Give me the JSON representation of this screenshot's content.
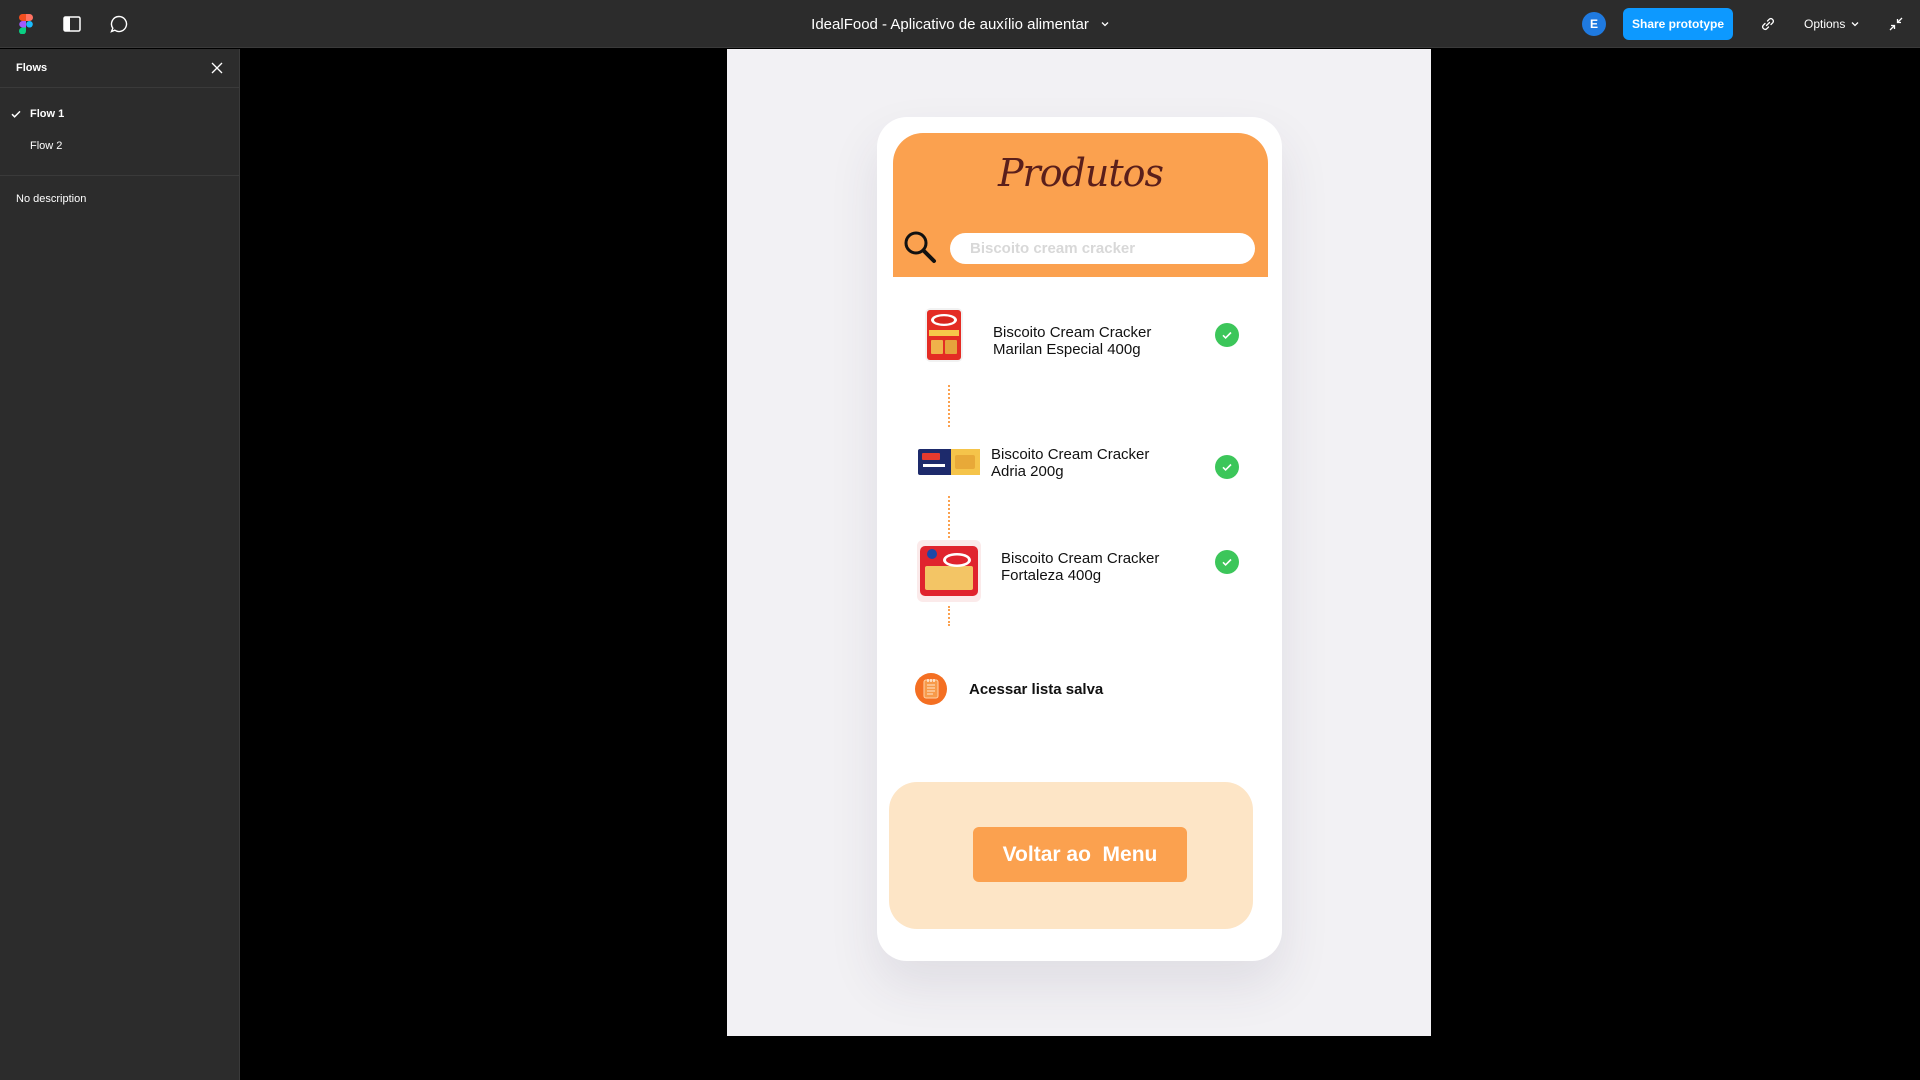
{
  "topbar": {
    "file_title": "IdealFood - Aplicativo de auxílio alimentar",
    "avatar_initial": "E",
    "share_label": "Share prototype",
    "options_label": "Options"
  },
  "sidebar": {
    "title": "Flows",
    "flows": [
      {
        "label": "Flow 1",
        "active": true
      },
      {
        "label": "Flow 2",
        "active": false
      }
    ],
    "description": "No description"
  },
  "app": {
    "brand": "Produtos",
    "search": {
      "placeholder": "Biscoito cream cracker"
    },
    "products": [
      {
        "name_line1": "Biscoito Cream Cracker",
        "name_line2": "Marilan Especial 400g",
        "checked": true
      },
      {
        "name_line1": "Biscoito Cream Cracker",
        "name_line2": "Adria 200g",
        "checked": true
      },
      {
        "name_line1": "Biscoito Cream Cracker",
        "name_line2": "Fortaleza 400g",
        "checked": true
      }
    ],
    "saved_list_label": "Acessar lista salva",
    "back_button_label": "Voltar ao  Menu"
  },
  "colors": {
    "brand_orange": "#fba14f",
    "light_orange": "#fde5c6",
    "check_green": "#3cc65a",
    "figma_blue": "#0d99ff"
  },
  "icons": [
    "figma-logo-icon",
    "sidebar-toggle-icon",
    "comment-icon",
    "chevron-down-icon",
    "link-icon",
    "collapse-icon",
    "close-icon",
    "check-icon",
    "search-icon",
    "notepad-icon"
  ]
}
